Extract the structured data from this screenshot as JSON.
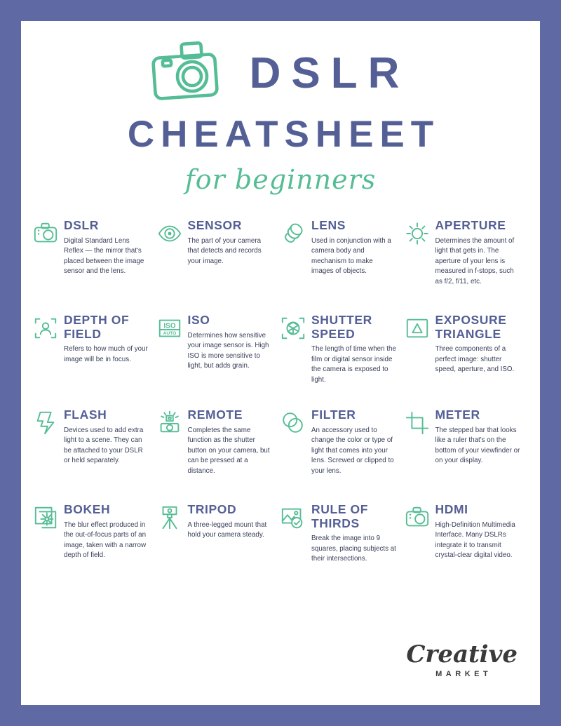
{
  "theme": {
    "frame_color": "#5f6aa4",
    "page_color": "#ffffff",
    "heading_color": "#545f95",
    "accent_green": "#55bd95",
    "body_text_color": "#39405a"
  },
  "header": {
    "logo_icon": "camera-icon",
    "title_line1": "DSLR",
    "title_line2": "CHEATSHEET",
    "subtitle": "for beginners"
  },
  "terms": [
    {
      "icon": "camera-icon",
      "title": "DSLR",
      "desc": "Digital Standard Lens Reflex — the mirror that's placed between the image sensor and the lens."
    },
    {
      "icon": "eye-icon",
      "title": "SENSOR",
      "desc": "The part of your camera that detects and records your image."
    },
    {
      "icon": "lens-icon",
      "title": "LENS",
      "desc": "Used in conjunction with a camera body and mechanism to make images of objects."
    },
    {
      "icon": "sun-icon",
      "title": "APERTURE",
      "desc": "Determines the amount of light that gets in. The aperture of your lens is measured in f-stops, such as f/2, f/11, etc."
    },
    {
      "icon": "portrait-focus-icon",
      "title": "DEPTH OF FIELD",
      "desc": "Refers to how much of your image will be in focus."
    },
    {
      "icon": "iso-auto-icon",
      "title": "ISO",
      "desc": "Determines how sensitive your image sensor is. High ISO is more sensitive to light, but adds grain."
    },
    {
      "icon": "aperture-blades-focus-icon",
      "title": "SHUTTER SPEED",
      "desc": "The length of time when the film or digital sensor inside the camera is exposed to light."
    },
    {
      "icon": "triangle-square-icon",
      "title": "EXPOSURE TRIANGLE",
      "desc": "Three components of a perfect image: shutter speed, aperture, and ISO."
    },
    {
      "icon": "lightning-bolt-icon",
      "title": "FLASH",
      "desc": "Devices used to add extra light to a scene. They can be attached to your DSLR or held separately."
    },
    {
      "icon": "remote-control-icon",
      "title": "REMOTE",
      "desc": "Completes the same function as the shutter button on your camera, but can be pressed at a distance."
    },
    {
      "icon": "overlapping-circles-icon",
      "title": "FILTER",
      "desc": "An accessory used to change the color or type of light that comes into your lens. Screwed or clipped to your lens."
    },
    {
      "icon": "crop-marks-icon",
      "title": "METER",
      "desc": "The stepped bar that looks like a ruler that's on the bottom of your viewfinder or on your display."
    },
    {
      "icon": "flower-photos-icon",
      "title": "BOKEH",
      "desc": "The blur effect produced in the out-of-focus parts of an image, taken with a narrow depth of field."
    },
    {
      "icon": "tripod-icon",
      "title": "TRIPOD",
      "desc": "A three-legged mount that hold your camera steady."
    },
    {
      "icon": "photo-check-icon",
      "title": "RULE OF THIRDS",
      "desc": "Break the image into 9 squares, placing subjects at their intersections."
    },
    {
      "icon": "camera-icon",
      "title": "HDMI",
      "desc": "High-Definition Multimedia Interface. Many DSLRs integrate it to transmit crystal-clear digital video."
    }
  ],
  "footer": {
    "brand_word": "Creative",
    "brand_sub": "MARKET"
  },
  "icon_labels": {
    "iso_top": "ISO",
    "iso_bottom": "AUTO"
  }
}
